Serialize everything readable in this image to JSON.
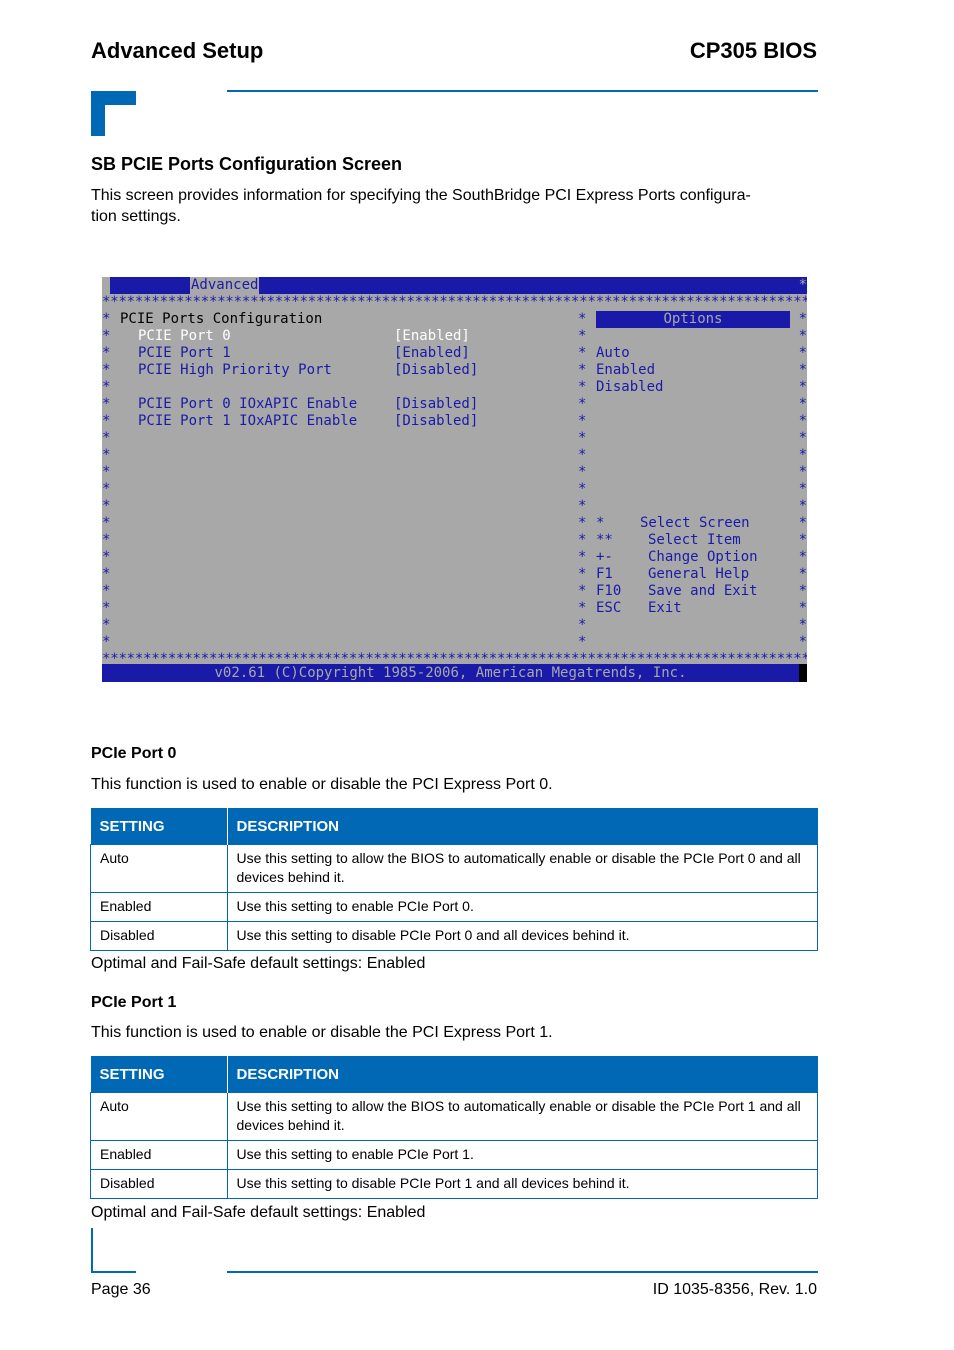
{
  "header": {
    "section": "Advanced Setup",
    "product": "CP305 BIOS"
  },
  "section": {
    "title": "SB PCIE Ports Configuration Screen",
    "intro": "This screen provides information for specifying the SouthBridge PCI Express Ports configura-tion settings."
  },
  "bios": {
    "tab": "Advanced",
    "screen_title": "PCIE Ports Configuration",
    "items": [
      {
        "label": "PCIE Port 0",
        "value": "[Enabled]",
        "selected": true
      },
      {
        "label": "PCIE Port 1",
        "value": "[Enabled]",
        "selected": false
      },
      {
        "label": "PCIE High Priority Port",
        "value": "[Disabled]",
        "selected": false
      },
      {
        "label": "PCIE Port 0 IOxAPIC Enable",
        "value": "[Disabled]",
        "selected": false
      },
      {
        "label": "PCIE Port 1 IOxAPIC Enable",
        "value": "[Disabled]",
        "selected": false
      }
    ],
    "options_header": "Options",
    "options": [
      "Auto",
      "Enabled",
      "Disabled"
    ],
    "keys": [
      {
        "key": "*",
        "desc": "Select Screen"
      },
      {
        "key": "**",
        "desc": "Select Item"
      },
      {
        "key": "+-",
        "desc": "Change Option"
      },
      {
        "key": "F1",
        "desc": "General Help"
      },
      {
        "key": "F10",
        "desc": "Save and Exit"
      },
      {
        "key": "ESC",
        "desc": "Exit"
      }
    ],
    "footer": "v02.61 (C)Copyright 1985-2006, American Megatrends, Inc.",
    "colors": {
      "background": "#a8a8a8",
      "accent": "#1a1aa8",
      "highlight": "#ffffff"
    }
  },
  "pcie_port0": {
    "title": "PCIe Port 0",
    "intro": "This function is used to enable or disable the PCI Express Port 0.",
    "table": {
      "headers": [
        "SETTING",
        "DESCRIPTION"
      ],
      "rows": [
        [
          "Auto",
          "Use this setting to allow the BIOS to automatically enable or disable the PCIe Port 0 and all devices behind it."
        ],
        [
          "Enabled",
          "Use this setting to enable PCIe Port 0."
        ],
        [
          "Disabled",
          "Use this setting to disable PCIe Port 0 and all devices behind it."
        ]
      ]
    },
    "default": "Optimal and Fail-Safe default settings: Enabled"
  },
  "pcie_port1": {
    "title": "PCIe Port 1",
    "intro": "This function is used to enable or disable the PCI Express Port 1.",
    "table": {
      "headers": [
        "SETTING",
        "DESCRIPTION"
      ],
      "rows": [
        [
          "Auto",
          "Use this setting to allow the BIOS to automatically enable or disable the PCIe Port 1 and all devices behind it."
        ],
        [
          "Enabled",
          "Use this setting to enable PCIe Port 1."
        ],
        [
          "Disabled",
          "Use this setting to disable PCIe Port 1 and all devices behind it."
        ]
      ]
    },
    "default": "Optimal and Fail-Safe default settings: Enabled"
  },
  "footer": {
    "page": "Page 36",
    "doc_id": "ID 1035-8356, Rev. 1.0"
  },
  "brand_color": "#0068b5"
}
